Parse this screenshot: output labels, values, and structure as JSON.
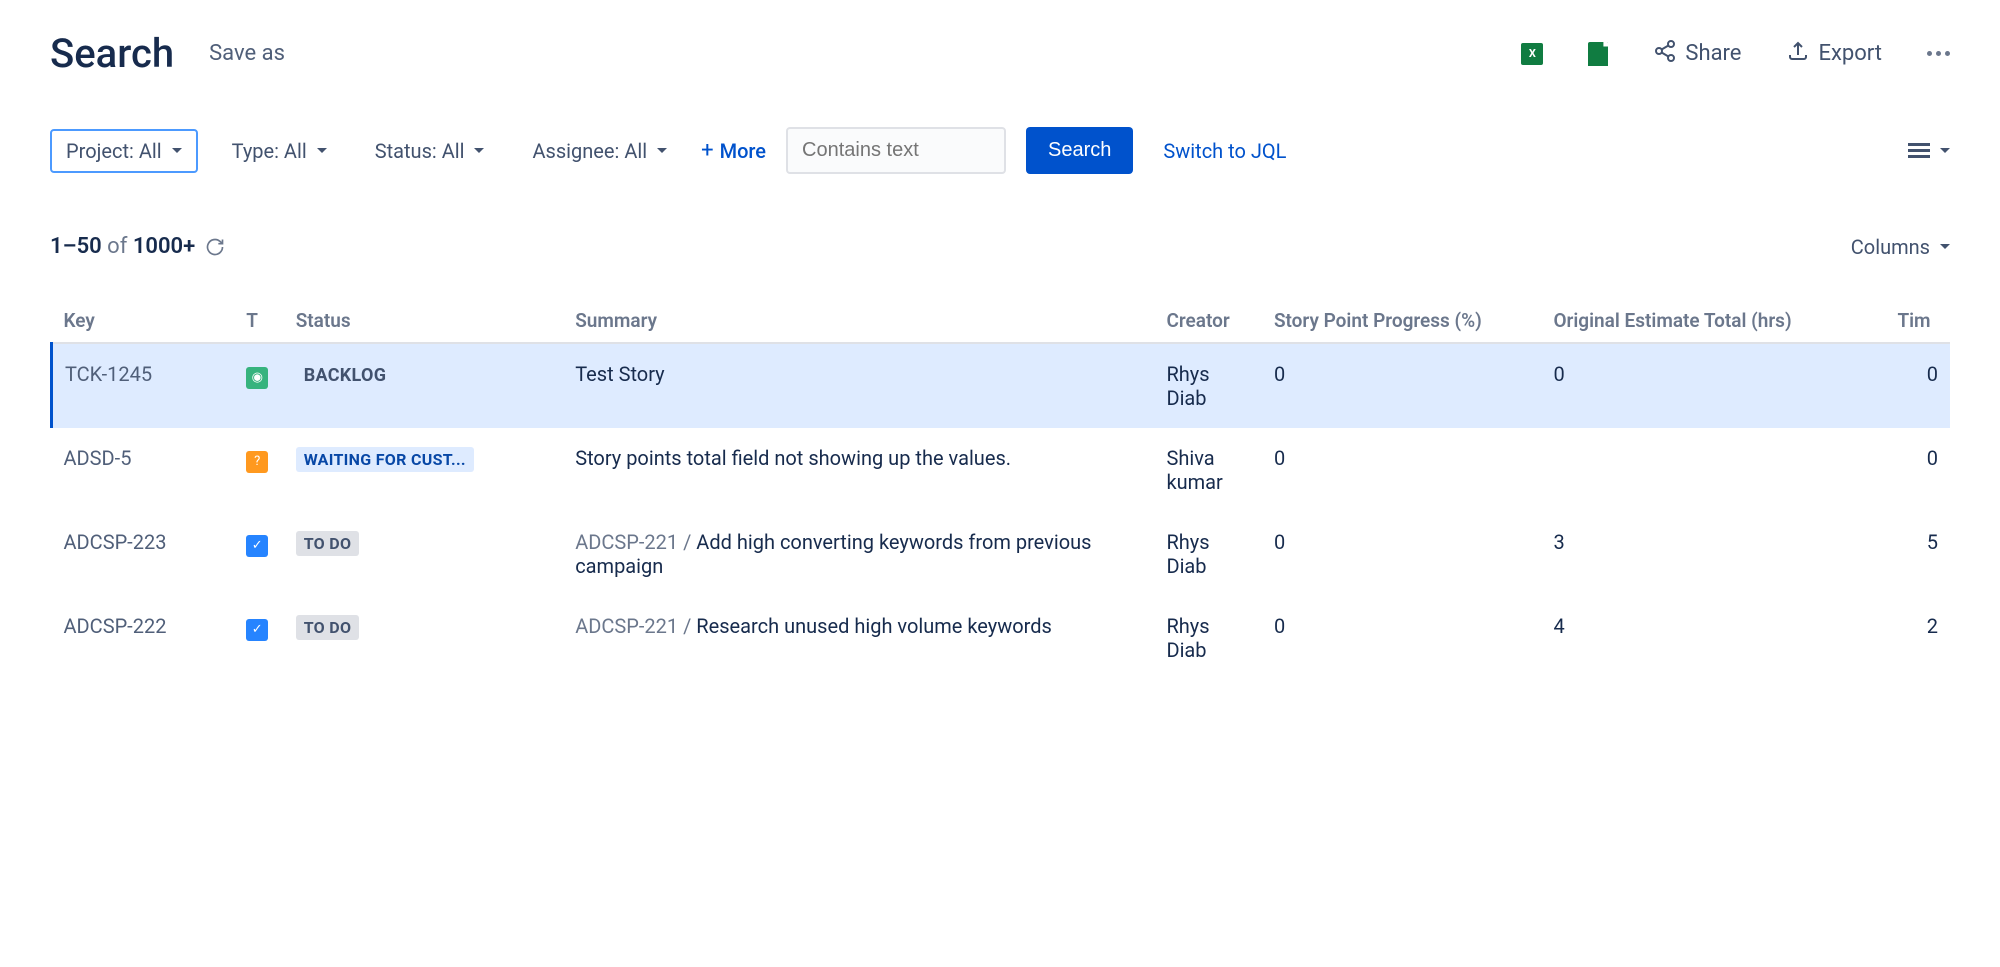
{
  "header": {
    "title": "Search",
    "save_as": "Save as",
    "share": "Share",
    "export": "Export"
  },
  "filters": {
    "project": "Project: All",
    "type": "Type: All",
    "status": "Status: All",
    "assignee": "Assignee: All",
    "more": "More",
    "search_placeholder": "Contains text",
    "search_btn": "Search",
    "switch_jql": "Switch to JQL"
  },
  "results": {
    "range": "1–50",
    "of_label": "of",
    "total": "1000+",
    "columns_btn": "Columns"
  },
  "columns": {
    "key": "Key",
    "t": "T",
    "status": "Status",
    "summary": "Summary",
    "creator": "Creator",
    "spp": "Story Point Progress (%)",
    "oet": "Original Estimate Total (hrs)",
    "tim": "Tim"
  },
  "rows": [
    {
      "key": "TCK-1245",
      "type": "story",
      "status_text": "BACKLOG",
      "status_class": "status-backlog",
      "summary_parent": "",
      "summary": "Test Story",
      "creator": "Rhys Diab",
      "spp": "0",
      "oet": "0",
      "tim": "0",
      "selected": true
    },
    {
      "key": "ADSD-5",
      "type": "question",
      "status_text": "WAITING FOR CUST...",
      "status_class": "status-waiting",
      "summary_parent": "",
      "summary": "Story points total field not showing up the values.",
      "creator": "Shiva kumar",
      "spp": "0",
      "oet": "",
      "tim": "0",
      "selected": false
    },
    {
      "key": "ADCSP-223",
      "type": "task",
      "status_text": "TO DO",
      "status_class": "status-todo",
      "summary_parent": "ADCSP-221 / ",
      "summary": "Add high converting keywords from previous campaign",
      "creator": "Rhys Diab",
      "spp": "0",
      "oet": "3",
      "tim": "5",
      "selected": false
    },
    {
      "key": "ADCSP-222",
      "type": "task",
      "status_text": "TO DO",
      "status_class": "status-todo",
      "summary_parent": "ADCSP-221 / ",
      "summary": "Research unused high volume keywords",
      "creator": "Rhys Diab",
      "spp": "0",
      "oet": "4",
      "tim": "2",
      "selected": false
    }
  ]
}
